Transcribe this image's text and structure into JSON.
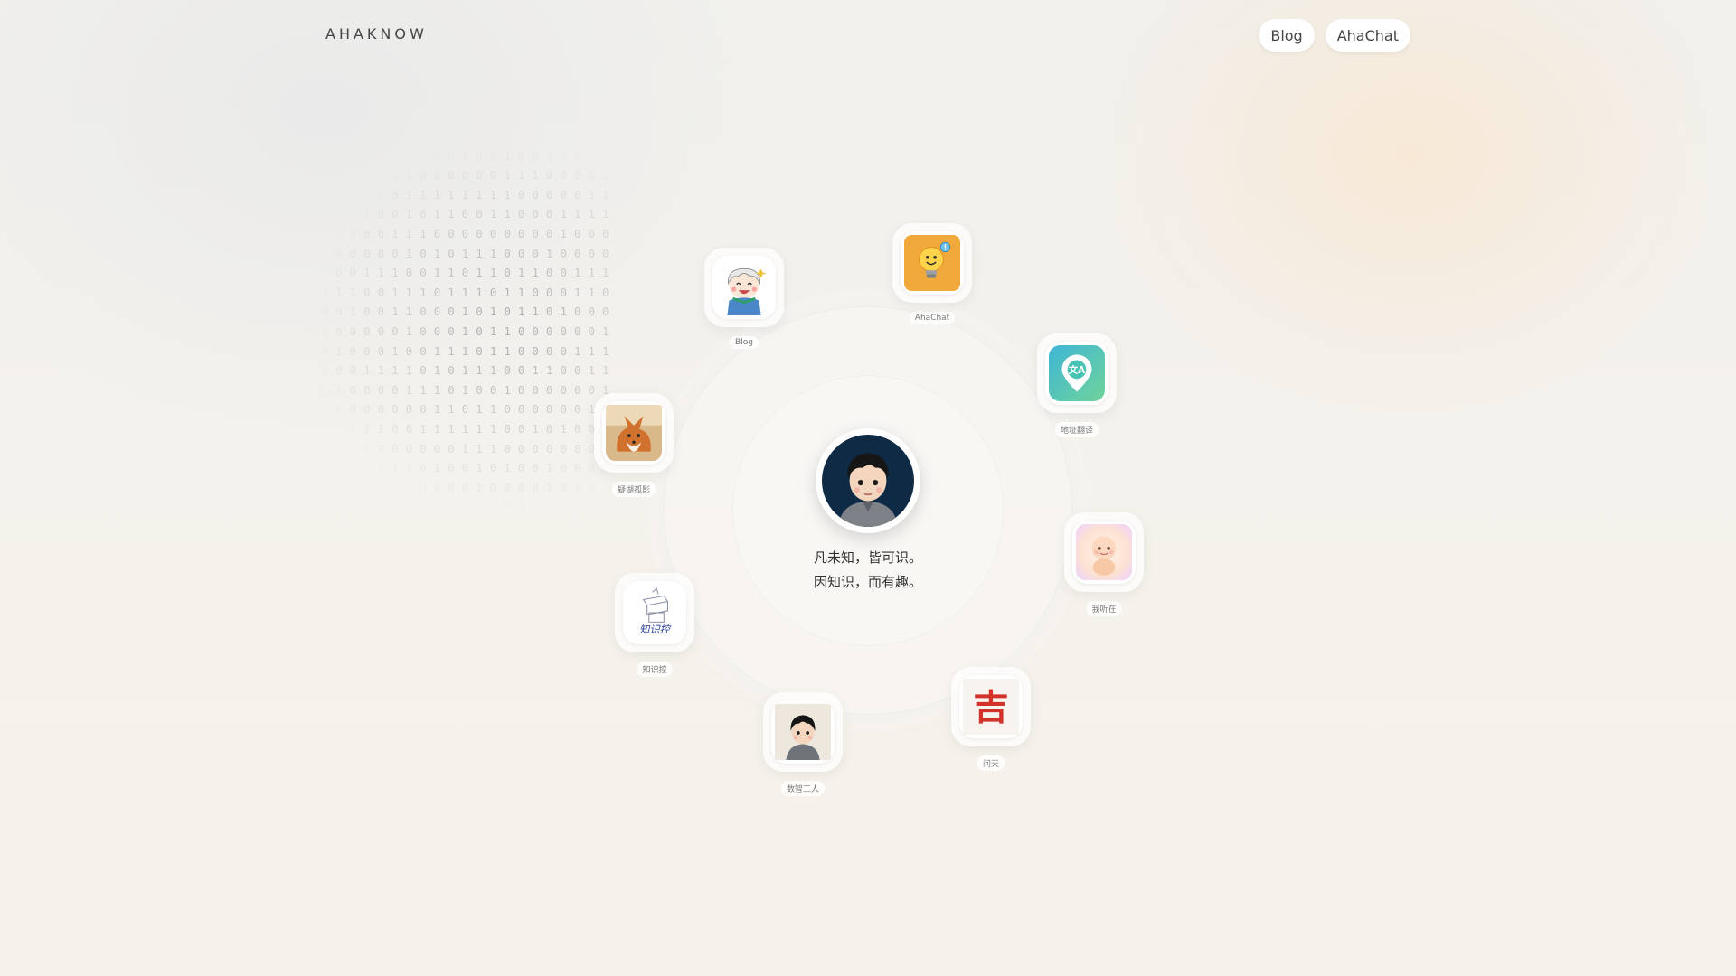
{
  "brand": "AHAKNOW",
  "nav": {
    "blog": "Blog",
    "ahachat": "AhaChat"
  },
  "motto": {
    "line1": "凡未知，皆可识。",
    "line2": "因知识，而有趣。"
  },
  "apps": [
    {
      "label": "Blog",
      "icon": "blog-mascot-icon"
    },
    {
      "label": "AhaChat",
      "icon": "lightbulb-icon"
    },
    {
      "label": "地址翻译",
      "icon": "map-pin-translate-icon"
    },
    {
      "label": "疑湖孤影",
      "icon": "fox-icon"
    },
    {
      "label": "我听在",
      "icon": "baby-glow-icon"
    },
    {
      "label": "知识控",
      "icon": "books-sketch-icon"
    },
    {
      "label": "问天",
      "icon": "ji-character-icon"
    },
    {
      "label": "数智工人",
      "icon": "boy-avatar-icon"
    }
  ],
  "colors": {
    "background": "#f3f1ec",
    "accent_orange": "#f2a93b",
    "accent_teal": "#44c5b5",
    "ji_red": "#d3322b"
  }
}
